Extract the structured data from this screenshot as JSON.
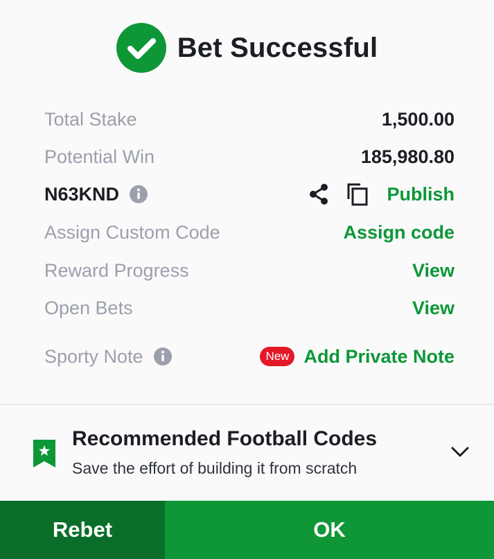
{
  "header": {
    "title": "Bet Successful",
    "icon": "check-circle-icon",
    "icon_color": "#0d9737"
  },
  "summary": {
    "total_stake_label": "Total Stake",
    "total_stake_value": "1,500.00",
    "potential_win_label": "Potential Win",
    "potential_win_value": "185,980.80",
    "booking_code": "N63KND",
    "publish_label": "Publish",
    "assign_label": "Assign Custom Code",
    "assign_link": "Assign code",
    "reward_label": "Reward Progress",
    "reward_link": "View",
    "open_bets_label": "Open Bets",
    "open_bets_link": "View",
    "note_label": "Sporty Note",
    "new_badge": "New",
    "note_link": "Add Private Note"
  },
  "recommend": {
    "title": "Recommended Football Codes",
    "subtitle": "Save the effort of building it from scratch"
  },
  "footer": {
    "rebet_label": "Rebet",
    "ok_label": "OK"
  },
  "colors": {
    "accent": "#0d9737",
    "dark_green": "#0a6e2a",
    "badge_red": "#e41827",
    "muted_text": "#9ca0ab"
  }
}
